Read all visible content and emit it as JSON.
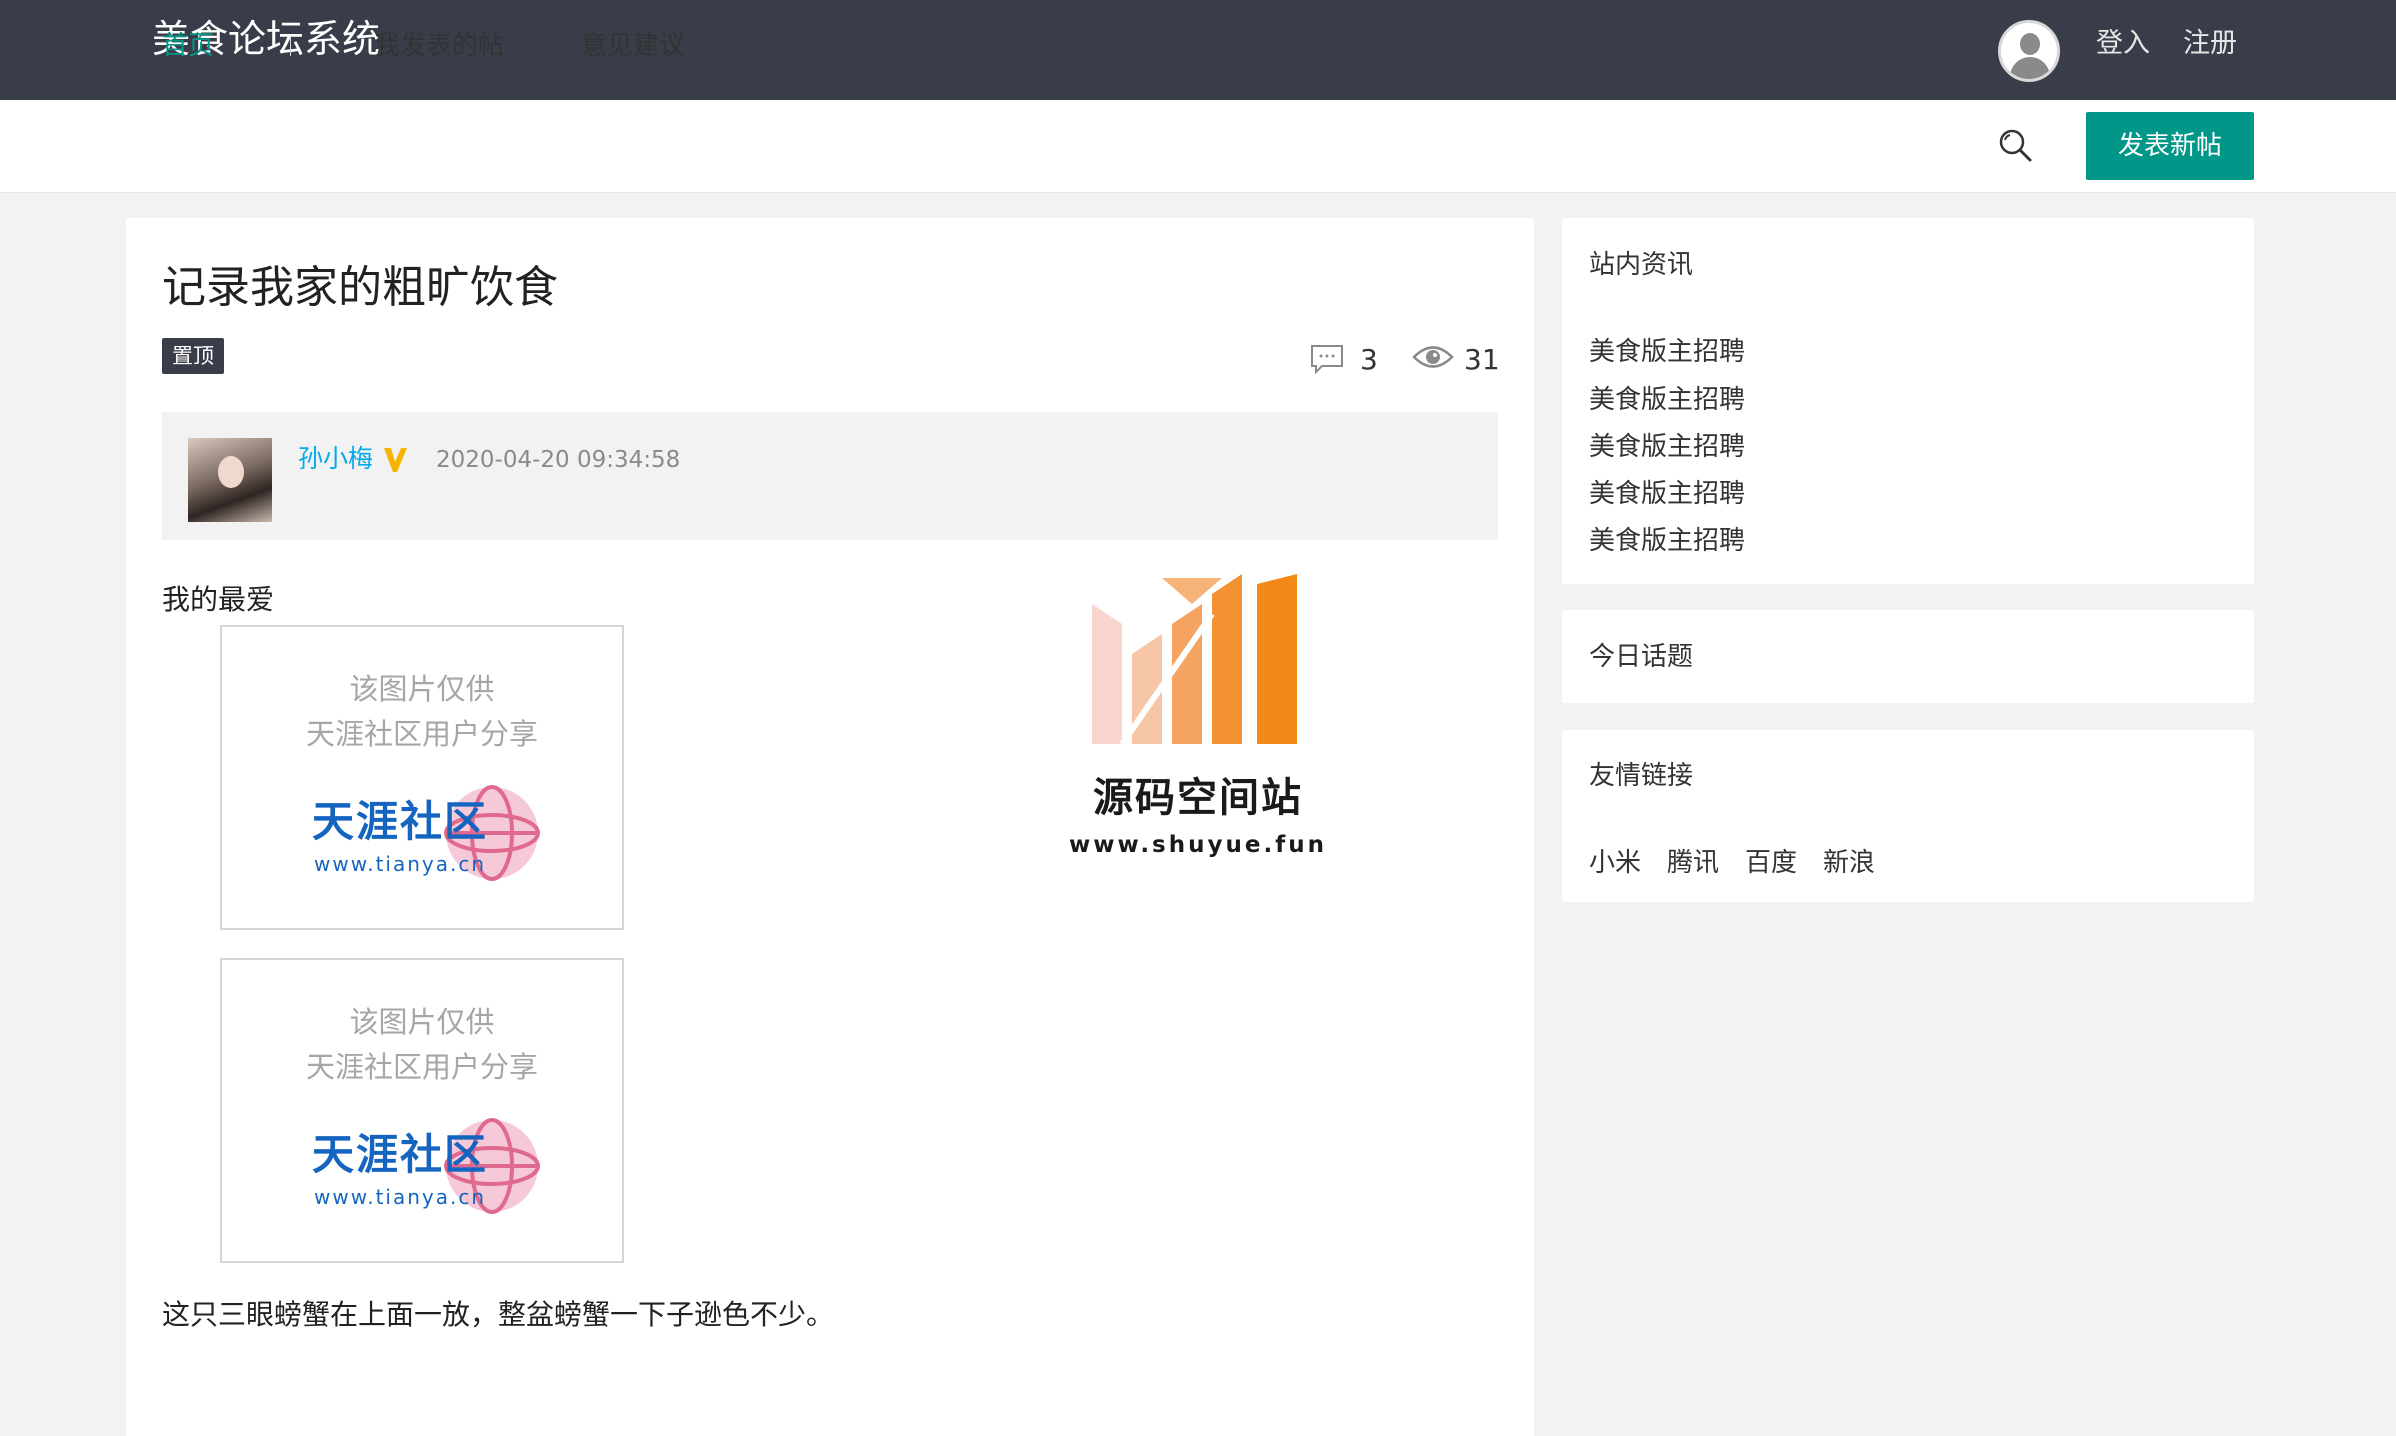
{
  "header": {
    "site_title": "美食论坛系统",
    "login_label": "登入",
    "register_label": "注册"
  },
  "nav": {
    "items": [
      {
        "label": "首页",
        "active": true
      },
      {
        "label": "我发表的帖",
        "active": false
      },
      {
        "label": "意见建议",
        "active": false
      }
    ],
    "new_post_label": "发表新帖",
    "accent_color": "#009688"
  },
  "post": {
    "title": "记录我家的粗旷饮食",
    "badge": "置顶",
    "comment_count": "3",
    "view_count": "31",
    "author": {
      "name": "孙小梅",
      "time": "2020-04-20 09:34:58"
    },
    "content": {
      "intro": "我的最爱",
      "images": [
        {
          "note_line1": "该图片仅供",
          "note_line2": "天涯社区用户分享",
          "logo_text": "天涯社区",
          "logo_url": "www.tianya.cn"
        },
        {
          "note_line1": "该图片仅供",
          "note_line2": "天涯社区用户分享",
          "logo_text": "天涯社区",
          "logo_url": "www.tianya.cn"
        }
      ],
      "closing": "这只三眼螃蟹在上面一放，整盆螃蟹一下子逊色不少。"
    }
  },
  "watermark": {
    "title": "源码空间站",
    "url": "www.shuyue.fun"
  },
  "sidebar": {
    "news": {
      "heading": "站内资讯",
      "items": [
        "美食版主招聘",
        "美食版主招聘",
        "美食版主招聘",
        "美食版主招聘",
        "美食版主招聘"
      ]
    },
    "topics": {
      "heading": "今日话题"
    },
    "links": {
      "heading": "友情链接",
      "items": [
        "小米",
        "腾讯",
        "百度",
        "新浪"
      ]
    }
  }
}
